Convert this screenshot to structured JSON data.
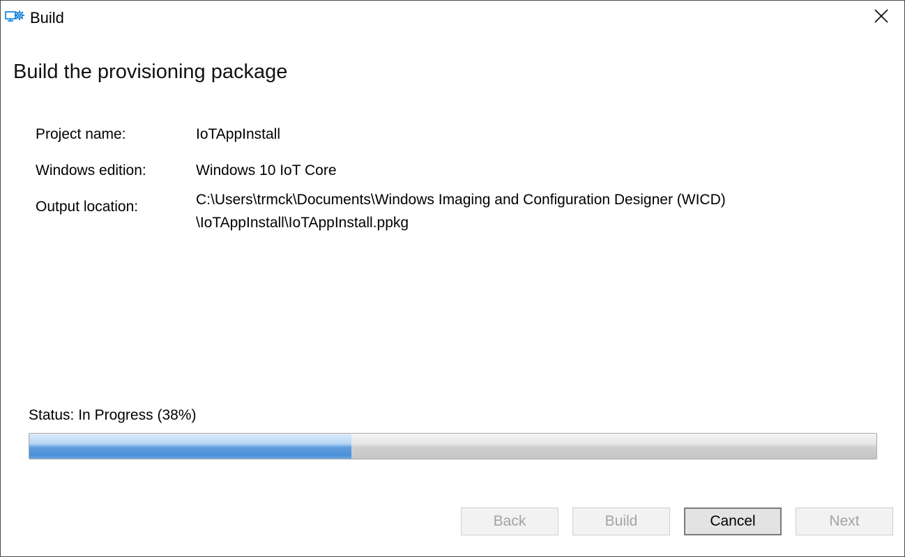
{
  "window": {
    "title": "Build",
    "icon": "provisioning-settings-icon",
    "close_icon": "close-icon"
  },
  "page": {
    "heading": "Build the provisioning package"
  },
  "info": {
    "project_name": {
      "label": "Project name:",
      "value": "IoTAppInstall"
    },
    "windows_edition": {
      "label": "Windows edition:",
      "value": "Windows 10 IoT Core"
    },
    "output_location": {
      "label": "Output location:",
      "value_line1": "C:\\Users\\trmck\\Documents\\Windows Imaging and Configuration Designer (WICD)",
      "value_line2": "\\IoTAppInstall\\IoTAppInstall.ppkg"
    }
  },
  "status": {
    "label": "Status:",
    "state": "In Progress",
    "percent_text": "(38%)",
    "progress": 0.38
  },
  "buttons": {
    "back": {
      "label": "Back",
      "enabled": false
    },
    "build": {
      "label": "Build",
      "enabled": false
    },
    "cancel": {
      "label": "Cancel",
      "enabled": true
    },
    "next": {
      "label": "Next",
      "enabled": false
    }
  },
  "colors": {
    "accent": "#0078d7",
    "progress_fill": "#4a8fd6",
    "disabled_text": "#a3a3a3"
  }
}
